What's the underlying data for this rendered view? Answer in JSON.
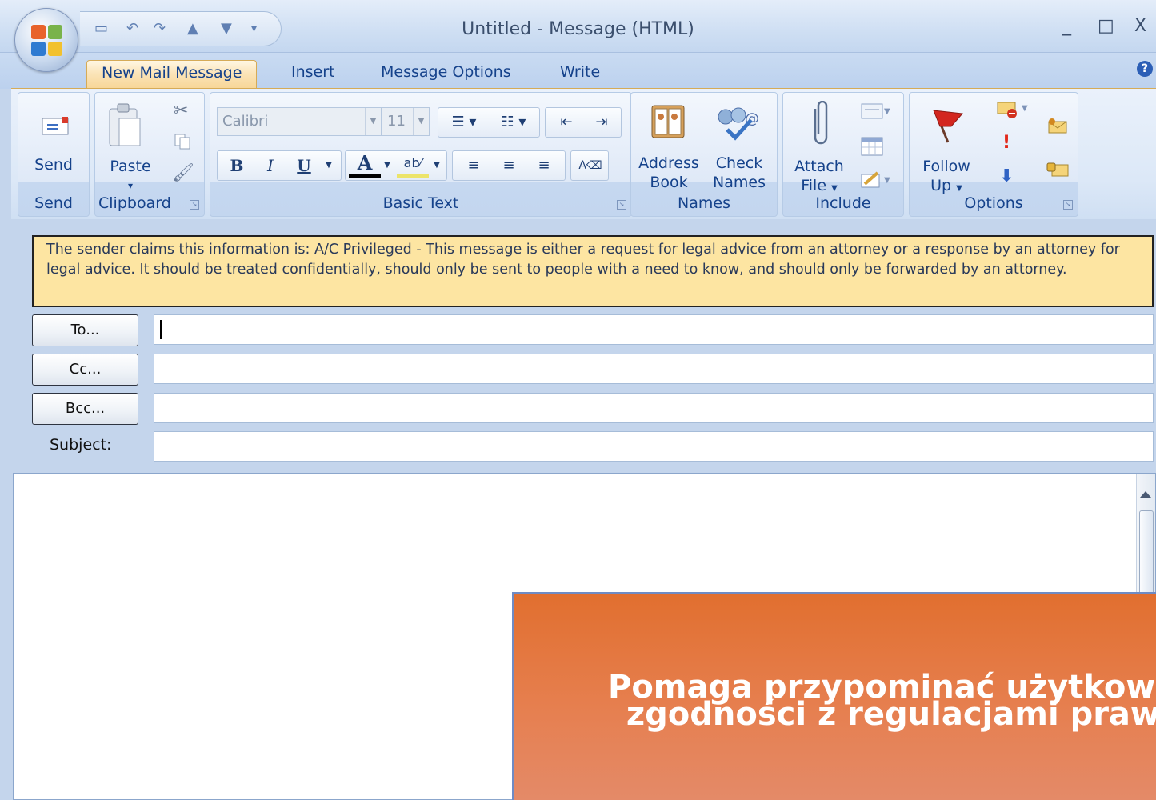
{
  "window": {
    "title": "Untitled - Message (HTML)",
    "controls": {
      "minimize": "_",
      "maximize": "□",
      "close": "X"
    }
  },
  "tabs": [
    {
      "label": "New Mail Message",
      "active": true
    },
    {
      "label": "Insert",
      "active": false
    },
    {
      "label": "Message Options",
      "active": false
    },
    {
      "label": "Write",
      "active": false
    }
  ],
  "ribbon": {
    "send": {
      "button": "Send",
      "group": "Send"
    },
    "clipboard": {
      "paste": "Paste",
      "group": "Clipboard"
    },
    "basic_text": {
      "font": "Calibri",
      "size": "11",
      "bold": "B",
      "italic": "I",
      "underline": "U",
      "font_color": "A",
      "group": "Basic Text"
    },
    "names": {
      "address_book": [
        "Address",
        "Book"
      ],
      "check_names": [
        "Check",
        "Names"
      ],
      "group": "Names"
    },
    "include": {
      "attach_file": [
        "Attach",
        "File"
      ],
      "group": "Include"
    },
    "options": {
      "follow_up": [
        "Follow",
        "Up"
      ],
      "group": "Options"
    }
  },
  "infobar": {
    "text": "The sender claims this information is: A/C Privileged - This message is either a request for legal advice from an attorney or a response by an attorney for legal advice. It should be treated confidentially, should only be sent to people with a need to know, and should only be forwarded by an attorney."
  },
  "address": {
    "to": "To...",
    "cc": "Cc...",
    "bcc": "Bcc...",
    "subject_label": "Subject:",
    "to_value": "",
    "cc_value": "",
    "bcc_value": "",
    "subject_value": ""
  },
  "body": {
    "text": ""
  },
  "caption": {
    "line1": "Pomaga przypominać użytkown",
    "line2": "zgodności z regulacjami praw"
  },
  "colors": {
    "accent": "#15428b",
    "infobar": "#fde5a2",
    "caption_bg": "#e16f2f"
  }
}
